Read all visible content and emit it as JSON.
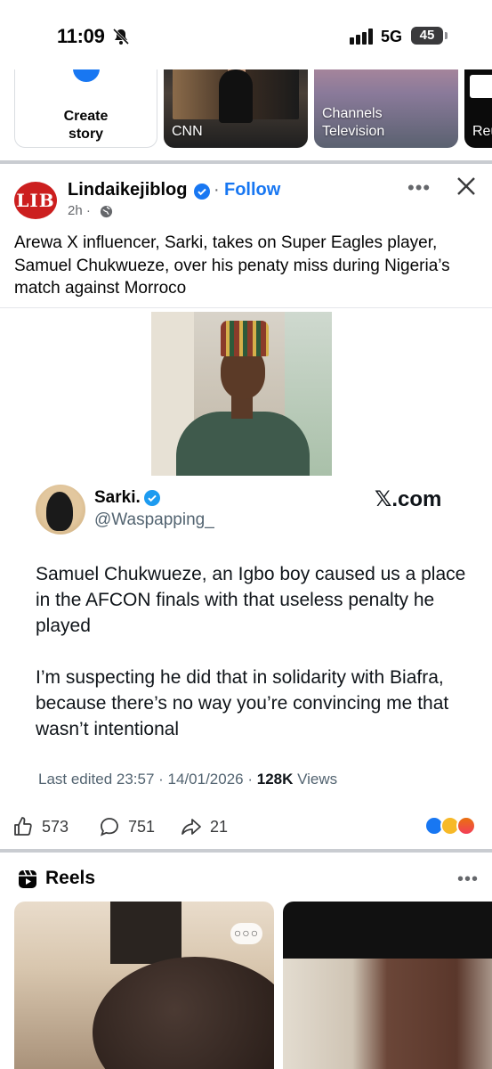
{
  "status": {
    "time": "11:09",
    "network": "5G",
    "battery": "45"
  },
  "stories": [
    {
      "label": "Create\nstory"
    },
    {
      "label": "CNN"
    },
    {
      "label": "Channels\nTelevision"
    },
    {
      "label": "Reu"
    }
  ],
  "post": {
    "page_name": "Lindaikejiblog",
    "logo_text": "LIB",
    "follow": "Follow",
    "separator": "·",
    "time": "2h ·",
    "more": "•••",
    "text": "Arewa X influencer, Sarki, takes on Super Eagles player,  Samuel Chukwueze, over his penaty miss during Nigeria’s match against Morroco"
  },
  "tweet": {
    "name": "Sarki.",
    "handle": "@Waspapping_",
    "source": "𝕏.com",
    "paragraph1": "Samuel Chukwueze, an Igbo boy caused us a place in the AFCON finals with that useless penalty he played",
    "paragraph2": "I’m suspecting he did that in solidarity with Biafra, because there’s no way you’re convincing me that wasn’t intentional",
    "meta_prefix": "Last edited 23:57 · 14/01/2026 · ",
    "views_count": "128K",
    "views_label": " Views"
  },
  "actions": {
    "likes": "573",
    "comments": "751",
    "shares": "21"
  },
  "reels": {
    "title": "Reels",
    "more": "•••",
    "reel_more": "○○○"
  },
  "colors": {
    "accent": "#1877f2",
    "lib_red": "#cc1f1f",
    "divider": "#c9ccd1"
  }
}
